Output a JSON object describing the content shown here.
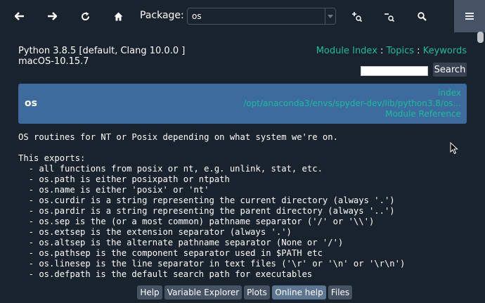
{
  "toolbar": {
    "package_label": "Package:",
    "package_value": "os",
    "icons": [
      "back-arrow-icon",
      "forward-arrow-icon",
      "refresh-icon",
      "home-icon",
      "zoom-in-icon",
      "zoom-out-icon",
      "search-icon",
      "hamburger-menu-icon"
    ]
  },
  "header": {
    "python_version": "Python 3.8.5 [default, Clang 10.0.0 ]",
    "os_version": "macOS-10.15.7",
    "links": {
      "module_index": "Module Index",
      "topics": "Topics",
      "keywords": "Keywords",
      "sep1": " : ",
      "sep2": " : "
    },
    "search_button": "Search"
  },
  "banner": {
    "module_name": "os",
    "index_link": "index",
    "path_link": "/opt/anaconda3/envs/spyder-dev/lib/python3.8/os...",
    "reference_link": "Module Reference"
  },
  "doc": {
    "summary": "OS routines for NT or Posix depending on what system we're on.",
    "exports_heading": "This exports:",
    "lines": [
      "  - all functions from posix or nt, e.g. unlink, stat, etc.",
      "  - os.path is either posixpath or ntpath",
      "  - os.name is either 'posix' or 'nt'",
      "  - os.curdir is a string representing the current directory (always '.')",
      "  - os.pardir is a string representing the parent directory (always '..')",
      "  - os.sep is the (or a most common) pathname separator ('/' or '\\\\')",
      "  - os.extsep is the extension separator (always '.')",
      "  - os.altsep is the alternate pathname separator (None or '/')",
      "  - os.pathsep is the component separator used in $PATH etc",
      "  - os.linesep is the line separator in text files ('\\r' or '\\n' or '\\r\\n')",
      "  - os.defpath is the default search path for executables"
    ]
  },
  "tabs": [
    {
      "label": "Help",
      "active": false
    },
    {
      "label": "Variable Explorer",
      "active": false
    },
    {
      "label": "Plots",
      "active": false
    },
    {
      "label": "Online help",
      "active": true
    },
    {
      "label": "Files",
      "active": false
    }
  ]
}
